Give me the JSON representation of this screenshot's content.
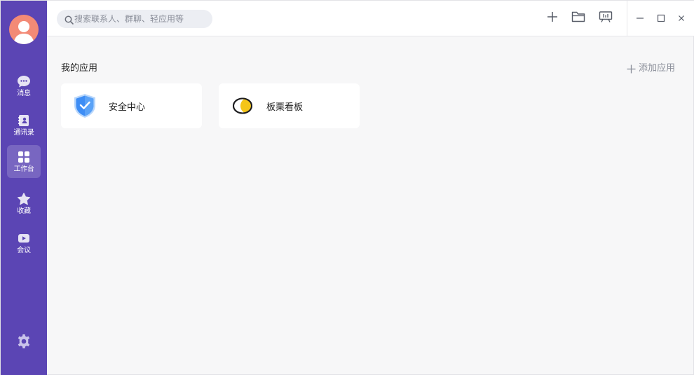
{
  "search": {
    "placeholder": "搜索联系人、群聊、轻应用等"
  },
  "sidebar": {
    "items": [
      {
        "label": "消息",
        "icon": "chat-bubble-icon"
      },
      {
        "label": "通讯录",
        "icon": "contacts-book-icon"
      },
      {
        "label": "工作台",
        "icon": "grid-apps-icon",
        "active": true
      },
      {
        "label": "收藏",
        "icon": "star-icon"
      },
      {
        "label": "会议",
        "icon": "video-camera-icon"
      }
    ],
    "settings_icon": "gear-icon"
  },
  "toolbar": {
    "add_icon": "plus-icon",
    "folder_icon": "folder-icon",
    "screen_icon": "presentation-screen-icon"
  },
  "window_controls": {
    "minimize": "—",
    "maximize": "□",
    "close": "×"
  },
  "main": {
    "section_title": "我的应用",
    "add_app_label": "添加应用",
    "apps": [
      {
        "name": "安全中心",
        "icon": "shield-check-icon"
      },
      {
        "name": "板栗看板",
        "icon": "chestnut-board-icon"
      }
    ]
  },
  "colors": {
    "sidebar_bg": "#5b45b4",
    "avatar_bg": "#f38a76",
    "shield_blue": "#3d8df5",
    "chestnut_yellow": "#f5c518"
  }
}
